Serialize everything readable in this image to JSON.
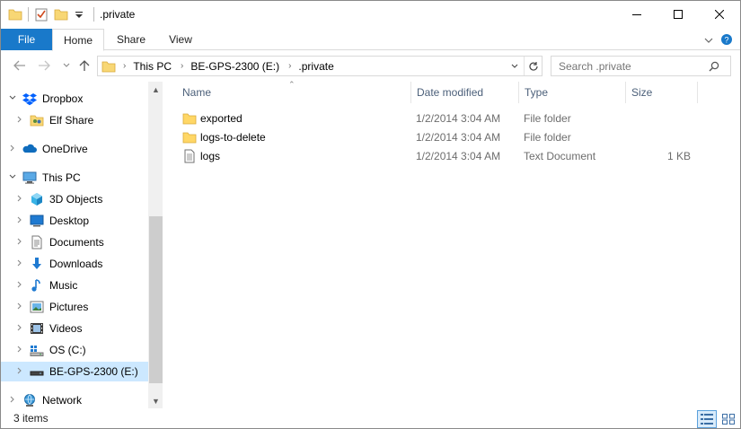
{
  "window": {
    "title": ".private",
    "minimize_glyph": "—",
    "maximize_glyph": "☐",
    "close_glyph": "✕"
  },
  "ribbon": {
    "tabs": [
      "File",
      "Home",
      "Share",
      "View"
    ],
    "active_tab": "Home",
    "file_tab_color": "#1979ca"
  },
  "address": {
    "crumbs": [
      "This PC",
      "BE-GPS-2300 (E:)",
      ".private"
    ],
    "search_placeholder": "Search .private"
  },
  "nav_tree": [
    {
      "label": "Dropbox",
      "icon": "dropbox-icon",
      "expander": "open",
      "selected": false
    },
    {
      "label": "Elf Share",
      "icon": "shared-folder-icon",
      "expander": "closed",
      "selected": false
    },
    {
      "label": "OneDrive",
      "icon": "onedrive-icon",
      "expander": "closed",
      "selected": false
    },
    {
      "label": "This PC",
      "icon": "this-pc-icon",
      "expander": "open",
      "selected": false
    },
    {
      "label": "3D Objects",
      "icon": "3d-objects-icon",
      "expander": "closed",
      "selected": false
    },
    {
      "label": "Desktop",
      "icon": "desktop-icon",
      "expander": "closed",
      "selected": false
    },
    {
      "label": "Documents",
      "icon": "documents-icon",
      "expander": "closed",
      "selected": false
    },
    {
      "label": "Downloads",
      "icon": "downloads-icon",
      "expander": "closed",
      "selected": false
    },
    {
      "label": "Music",
      "icon": "music-icon",
      "expander": "closed",
      "selected": false
    },
    {
      "label": "Pictures",
      "icon": "pictures-icon",
      "expander": "closed",
      "selected": false
    },
    {
      "label": "Videos",
      "icon": "videos-icon",
      "expander": "closed",
      "selected": false
    },
    {
      "label": "OS (C:)",
      "icon": "os-drive-icon",
      "expander": "closed",
      "selected": false
    },
    {
      "label": "BE-GPS-2300 (E:)",
      "icon": "usb-drive-icon",
      "expander": "closed",
      "selected": true
    },
    {
      "label": "Network",
      "icon": "network-icon",
      "expander": "closed",
      "selected": false
    }
  ],
  "columns": {
    "name": "Name",
    "date_modified": "Date modified",
    "type": "Type",
    "size": "Size"
  },
  "files": [
    {
      "name": "exported",
      "date_modified": "1/2/2014 3:04 AM",
      "type": "File folder",
      "size": "",
      "icon": "folder-icon"
    },
    {
      "name": "logs-to-delete",
      "date_modified": "1/2/2014 3:04 AM",
      "type": "File folder",
      "size": "",
      "icon": "folder-icon"
    },
    {
      "name": "logs",
      "date_modified": "1/2/2014 3:04 AM",
      "type": "Text Document",
      "size": "1 KB",
      "icon": "text-document-icon"
    }
  ],
  "status": {
    "item_count": "3 items"
  },
  "colors": {
    "selection": "#cce8ff",
    "folder_yellow": "#ffd766",
    "header_text": "#4c607a"
  }
}
